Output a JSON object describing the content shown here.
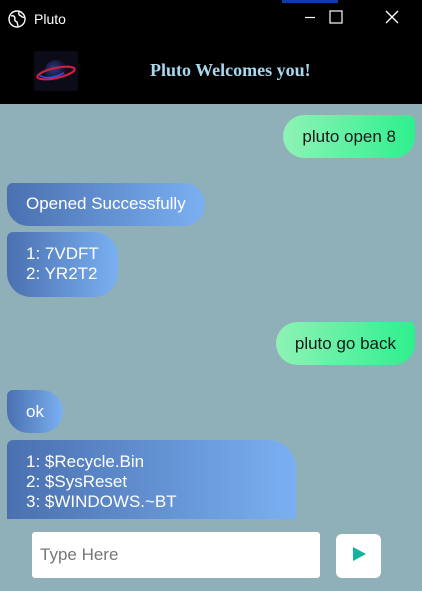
{
  "window": {
    "title": "Pluto",
    "icons": [
      "globe-icon",
      "minimize-icon",
      "maximize-icon",
      "close-icon"
    ]
  },
  "header": {
    "logo": "pluto-logo",
    "welcome_text": "Pluto Welcomes you!"
  },
  "messages": [
    {
      "from": "user",
      "lines": [
        "pluto open 8"
      ]
    },
    {
      "from": "bot",
      "lines": [
        "Opened Successfully"
      ]
    },
    {
      "from": "bot",
      "lines": [
        "1: 7VDFT",
        "2: YR2T2"
      ]
    },
    {
      "from": "user",
      "lines": [
        "pluto go back"
      ]
    },
    {
      "from": "bot",
      "lines": [
        "ok"
      ]
    },
    {
      "from": "bot",
      "lines": [
        "1: $Recycle.Bin",
        "2: $SysReset",
        "3: $WINDOWS.~BT"
      ]
    }
  ],
  "input": {
    "placeholder": "Type Here",
    "value": ""
  },
  "colors": {
    "chat_background": "#8fb0b8",
    "sent_bubble": "#2ef08e",
    "received_bubble": "#4a70b0",
    "send_icon": "#12b3a0",
    "header_text": "#a8d8f0"
  }
}
